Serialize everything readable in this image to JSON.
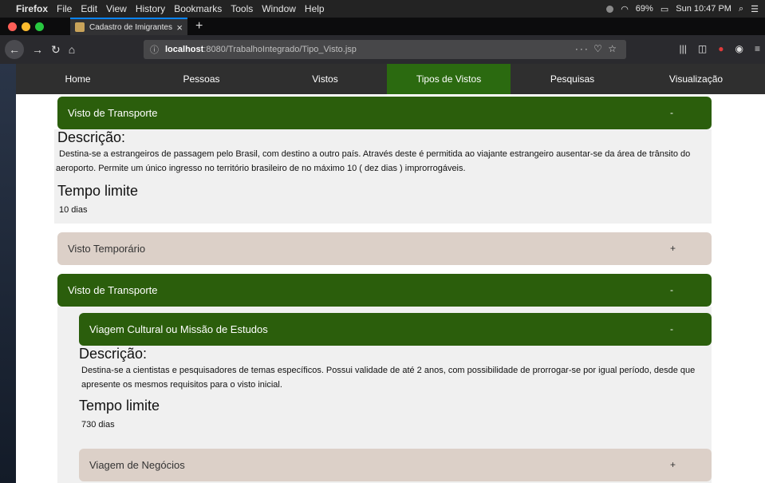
{
  "menubar": {
    "items": [
      "Firefox",
      "File",
      "Edit",
      "View",
      "History",
      "Bookmarks",
      "Tools",
      "Window",
      "Help"
    ],
    "battery": "69%",
    "clock": "Sun 10:47 PM"
  },
  "browser": {
    "tab_title": "Cadastro de Imigrantes",
    "url_host": "localhost",
    "url_rest": ":8080/TrabalhoIntegrado/Tipo_Visto.jsp"
  },
  "site_nav": {
    "items": [
      "Home",
      "Pessoas",
      "Vistos",
      "Tipos de Vistos",
      "Pesquisas",
      "Visualização"
    ],
    "active": "Tipos de Vistos"
  },
  "panels": {
    "p1": {
      "title": "Visto de Transporte",
      "toggle": "-",
      "desc_heading": "Descrição:",
      "desc_line1": "Destina-se a estrangeiros de passagem pelo Brasil, com destino a outro país. Através deste é permitida ao viajante estrangeiro ausentar-se da área de trânsito do",
      "desc_line2": "aeroporto. Permite um único ingresso no território brasileiro de no máximo 10 ( dez dias ) improrrogáveis.",
      "time_heading": "Tempo limite",
      "time_value": "10 dias"
    },
    "p2": {
      "title": "Visto Temporário",
      "toggle": "+"
    },
    "p3": {
      "title": "Visto de Transporte",
      "toggle": "-"
    },
    "p3a": {
      "title": "Viagem Cultural ou Missão de Estudos",
      "toggle": "-",
      "desc_heading": "Descrição:",
      "desc_line1": "Destina-se a cientistas e pesquisadores de temas específicos. Possui validade de até 2 anos, com possibilidade de prorrogar-se por igual período, desde que",
      "desc_line2": "apresente os mesmos requisitos para o visto inicial.",
      "time_heading": "Tempo limite",
      "time_value": "730 dias"
    },
    "p3b": {
      "title": "Viagem de Negócios",
      "toggle": "+"
    }
  },
  "colors": {
    "open_header": "#2b5e0c",
    "closed_header": "#dcd0c8",
    "active_nav": "#2b6a10"
  }
}
